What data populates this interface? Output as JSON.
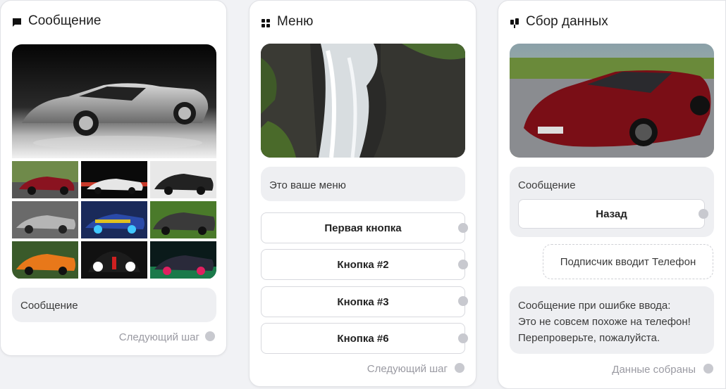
{
  "cards": {
    "message": {
      "title": "Сообщение",
      "icon": "chat-bubble-icon",
      "bubble_text": "Сообщение",
      "next_step": "Следующий шаг"
    },
    "menu": {
      "title": "Меню",
      "icon": "grid-icon",
      "bubble_text": "Это ваше меню",
      "buttons": [
        "Первая кнопка",
        "Кнопка #2",
        "Кнопка #3",
        "Кнопка #6"
      ],
      "next_step": "Следующий шаг"
    },
    "data": {
      "title": "Сбор данных",
      "icon": "data-icon",
      "bubble_label": "Сообщение",
      "back_button": "Назад",
      "subscriber_input": "Подписчик вводит Телефон",
      "error_line1": "Сообщение при ошибке ввода:",
      "error_line2": "Это не совсем похоже на телефон!",
      "error_line3": "Перепроверьте, пожалуйста.",
      "done_step": "Данные собраны"
    }
  },
  "colors": {
    "page_bg": "#f1f2f5",
    "bubble_bg": "#eeeff2",
    "connector_dot": "#c8c9cf",
    "muted_text": "#9a9aa2"
  }
}
